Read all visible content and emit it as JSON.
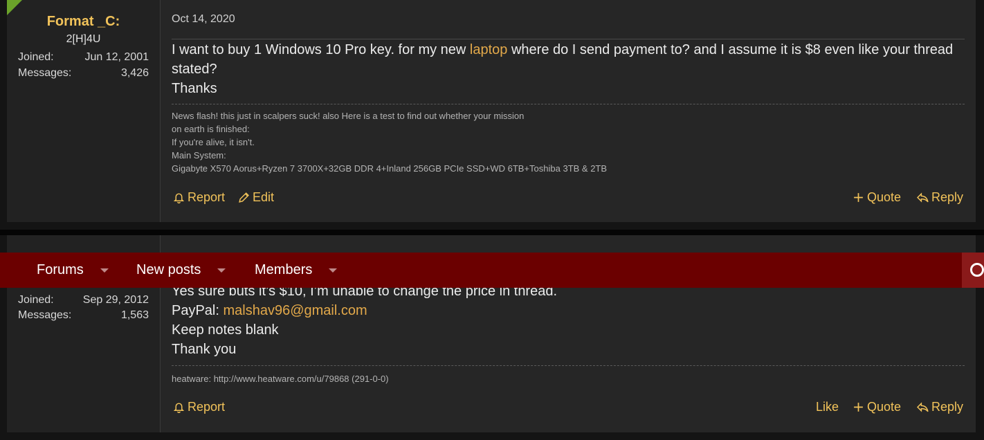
{
  "posts": [
    {
      "username": "Format _C:",
      "user_title": "2[H]4U",
      "joined_label": "Joined:",
      "joined_value": "Jun 12, 2001",
      "messages_label": "Messages:",
      "messages_value": "3,426",
      "date": "Oct 14, 2020",
      "body": {
        "line1_pre": "I want to buy 1 Windows 10 Pro key. for my new ",
        "line1_link": "laptop",
        "line1_post": " where do I send payment to? and I assume it is $8 even like your thread",
        "line2": "stated?",
        "line3": "Thanks"
      },
      "signature": [
        "News flash! this just in scalpers suck! also Here is a test to find out whether your mission",
        "on earth is finished:",
        "If you're alive, it isn't.",
        "Main System:",
        "Gigabyte X570 Aorus+Ryzen 7 3700X+32GB DDR 4+Inland 256GB PCIe SSD+WD 6TB+Toshiba 3TB & 2TB"
      ],
      "actions": {
        "report": "Report",
        "edit": "Edit",
        "quote": "Quote",
        "reply": "Reply"
      }
    },
    {
      "joined_label": "Joined:",
      "joined_value": "Sep 29, 2012",
      "messages_label": "Messages:",
      "messages_value": "1,563",
      "body": {
        "line1": "Yes sure buts it’s $10, I’m unable to change the price in thread.",
        "line2_pre": "PayPal: ",
        "line2_link": "malshav96@gmail.com",
        "line3": "Keep notes blank",
        "line4": "Thank you"
      },
      "signature": [
        "heatware: http://www.heatware.com/u/79868 (291-0-0)"
      ],
      "actions": {
        "report": "Report",
        "like": "Like",
        "quote": "Quote",
        "reply": "Reply"
      }
    }
  ],
  "nav": {
    "items": [
      "Forums",
      "New posts",
      "Members"
    ]
  },
  "colors": {
    "accent": "#f2c35a",
    "link": "#e3a94a",
    "navbar": "#6b0000",
    "post_bg": "#262626"
  }
}
